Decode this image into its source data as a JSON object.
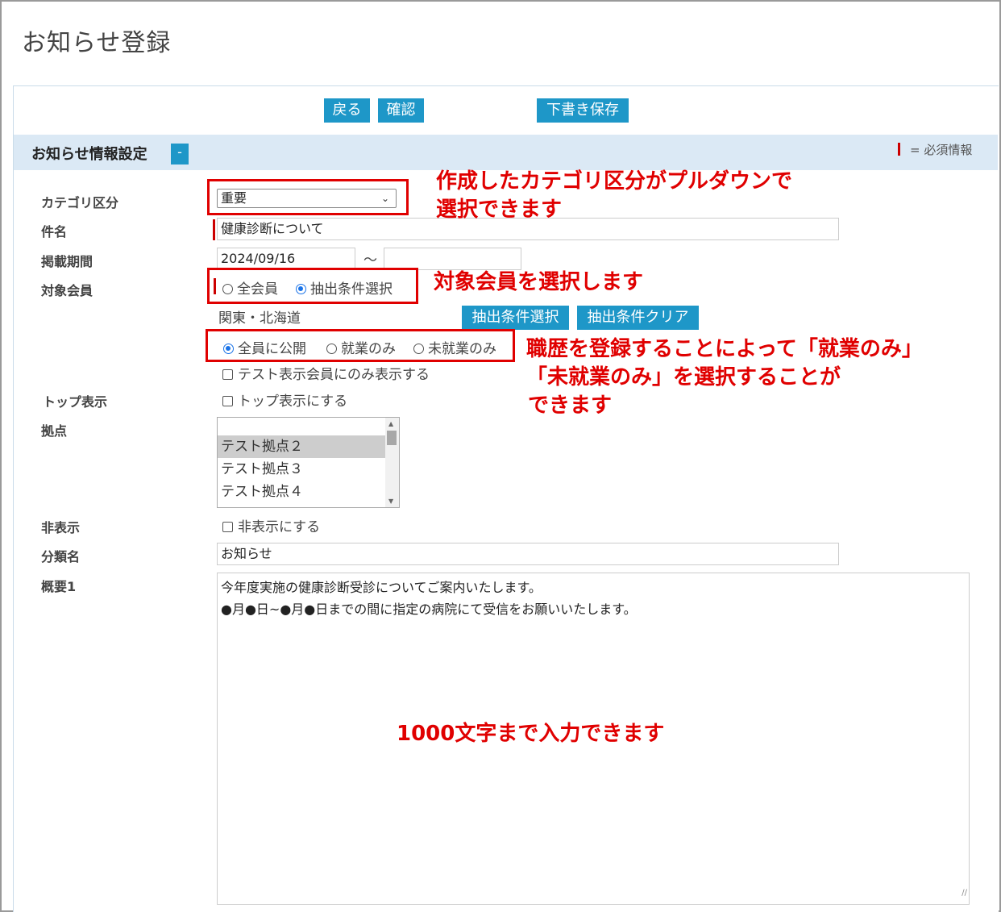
{
  "page_title": "お知らせ登録",
  "toolbar": {
    "back": "戻る",
    "confirm": "確認",
    "draft_save": "下書き保存"
  },
  "section": {
    "title": "お知らせ情報設定",
    "toggle": "-",
    "required_legend": "= 必須情報"
  },
  "labels": {
    "category": "カテゴリ区分",
    "subject": "件名",
    "period": "掲載期間",
    "target": "対象会員",
    "top_display": "トップ表示",
    "base": "拠点",
    "hidden": "非表示",
    "class_name": "分類名",
    "summary": "概要1"
  },
  "category": {
    "selected": "重要"
  },
  "subject": {
    "value": "健康診断について"
  },
  "period": {
    "start": "2024/09/16",
    "tilde": "〜",
    "end": ""
  },
  "target": {
    "option_all": "全会員",
    "option_extract": "抽出条件選択",
    "selected": "抽出条件選択"
  },
  "region": {
    "text": "関東・北海道"
  },
  "extract_buttons": {
    "select": "抽出条件選択",
    "clear": "抽出条件クリア"
  },
  "publish": {
    "all": "全員に公開",
    "employed": "就業のみ",
    "unemployed": "未就業のみ",
    "selected": "全員に公開"
  },
  "test_only": {
    "label": "テスト表示会員にのみ表示する",
    "checked": false
  },
  "top_display": {
    "label": "トップ表示にする",
    "checked": false
  },
  "bases": {
    "items": [
      "テスト拠点２",
      "テスト拠点３",
      "テスト拠点４"
    ],
    "selected": "テスト拠点２"
  },
  "hidden": {
    "label": "非表示にする",
    "checked": false
  },
  "class_name": {
    "value": "お知らせ"
  },
  "summary": {
    "line1": "今年度実施の健康診断受診についてご案内いたします。",
    "line2": "●月●日~●月●日までの間に指定の病院にて受信をお願いいたします。"
  },
  "annotations": {
    "category_note_1": "作成したカテゴリ区分がプルダウンで",
    "category_note_2": "選択できます",
    "target_note": "対象会員を選択します",
    "career_note_1": "職歴を登録することによって「就業のみ」",
    "career_note_2": "「未就業のみ」を選択することが",
    "career_note_3": "できます",
    "length_note": "1000文字まで入力できます"
  },
  "colors": {
    "accent": "#1e97c8",
    "annotation": "#e00000",
    "section_bg": "#dbe9f5",
    "required": "#cc0000"
  }
}
